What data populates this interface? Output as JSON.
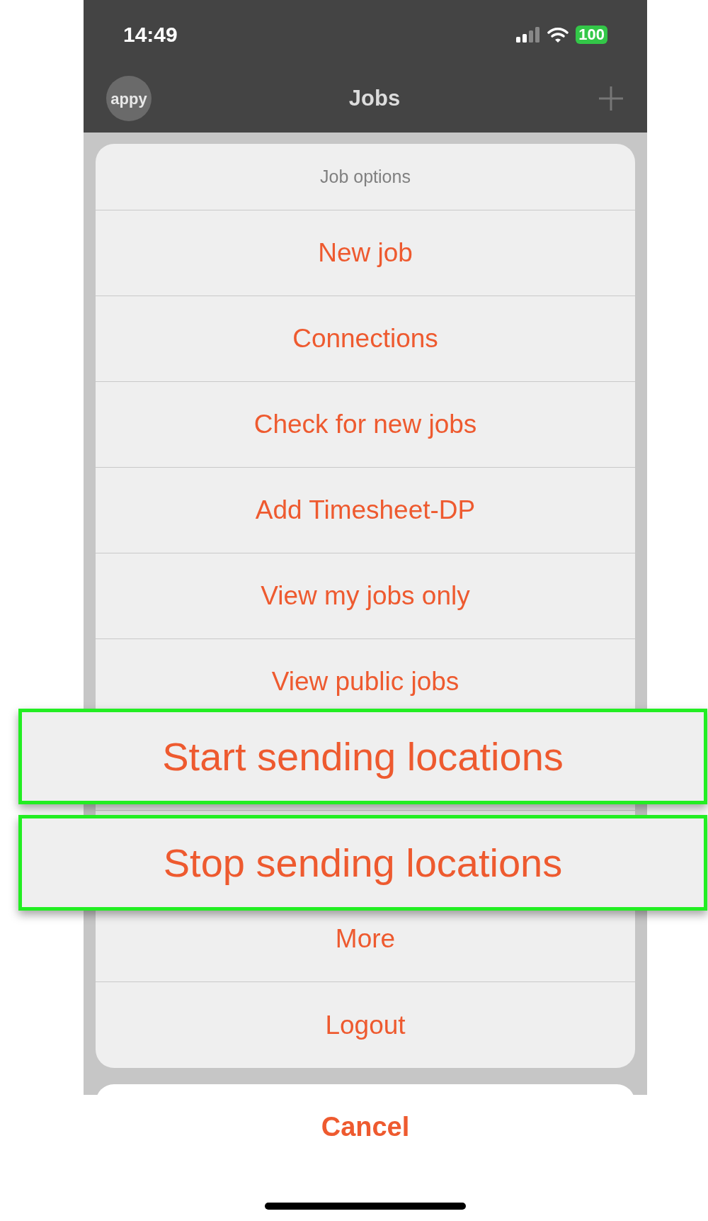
{
  "status_bar": {
    "time": "14:49",
    "battery": "100"
  },
  "nav_bar": {
    "logo": "appy",
    "title": "Jobs"
  },
  "action_sheet": {
    "title": "Job options",
    "options": [
      {
        "label": "New job",
        "kind": "option"
      },
      {
        "label": "Connections",
        "kind": "option"
      },
      {
        "label": "Check for new jobs",
        "kind": "option"
      },
      {
        "label": "Add Timesheet-DP",
        "kind": "option"
      },
      {
        "label": "View my jobs only",
        "kind": "option"
      },
      {
        "label": "View public jobs",
        "kind": "option"
      },
      {
        "label": "Start sending locations",
        "kind": "highlighted"
      },
      {
        "label": "Stop sending locations",
        "kind": "highlighted"
      },
      {
        "label": "More",
        "kind": "option"
      },
      {
        "label": "Logout",
        "kind": "option"
      }
    ],
    "cancel": "Cancel"
  }
}
